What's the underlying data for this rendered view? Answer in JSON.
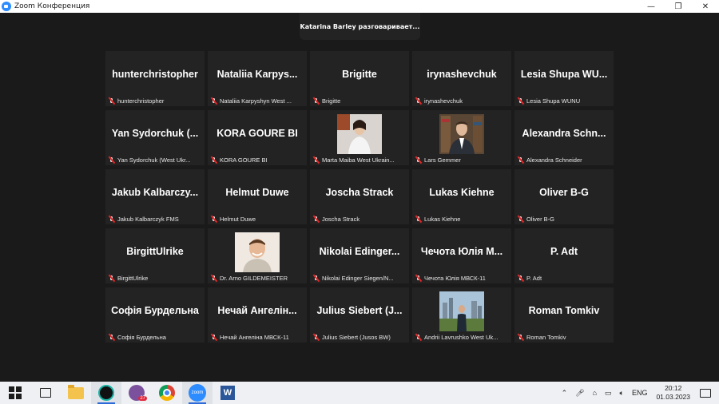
{
  "window": {
    "title": "Zoom Конференция",
    "controls": {
      "minimize": "—",
      "restore": "❐",
      "close": "✕"
    }
  },
  "banner": {
    "speaking": "Katarina Barley разговаривает..."
  },
  "tiles": [
    {
      "big": "hunterchristopher",
      "label": "hunterchristopher"
    },
    {
      "big": "Nataliia Karpys...",
      "label": "Nataliia Karpyshyn West ..."
    },
    {
      "big": "Brigitte",
      "label": "Brigitte"
    },
    {
      "big": "irynashevchuk",
      "label": "irynashevchuk"
    },
    {
      "big": "Lesia Shupa WU...",
      "label": "Lesia Shupa WUNU"
    },
    {
      "big": "Yan Sydorchuk (...",
      "label": "Yan Sydorchuk (West Ukr..."
    },
    {
      "big": "KORA GOURE BI",
      "label": "KORA GOURE BI"
    },
    {
      "big": "",
      "label": "Marta Maiba West Ukrain...",
      "photo": "woman-white-blouse"
    },
    {
      "big": "",
      "label": "Lars Gemmer",
      "photo": "man-suit-bookshelf"
    },
    {
      "big": "Alexandra Schn...",
      "label": "Alexandra Schneider"
    },
    {
      "big": "Jakub Kalbarczy...",
      "label": "Jakub Kalbarczyk FMS"
    },
    {
      "big": "Helmut Duwe",
      "label": "Helmut Duwe"
    },
    {
      "big": "Joscha Strack",
      "label": "Joscha Strack"
    },
    {
      "big": "Lukas Kiehne",
      "label": "Lukas Kiehne"
    },
    {
      "big": "Oliver B-G",
      "label": "Oliver B-G"
    },
    {
      "big": "BirgittUlrike",
      "label": "BirgittUlrike"
    },
    {
      "big": "",
      "label": "Dr. Arno GILDEMEISTER",
      "photo": "man-smiling"
    },
    {
      "big": "Nikolai Edinger...",
      "label": "Nikolai Edinger Siegen/N..."
    },
    {
      "big": "Чечота Юлія М...",
      "label": "Чечота Юлія МВСК-11"
    },
    {
      "big": "P. Adt",
      "label": "P. Adt"
    },
    {
      "big": "Софія Бурдельна",
      "label": "Софія Бурдельна"
    },
    {
      "big": "Нечай Ангелін...",
      "label": "Нечай Ангеліна МВСК-11"
    },
    {
      "big": "Julius Siebert (J...",
      "label": "Julius Siebert (Jusos BW)"
    },
    {
      "big": "",
      "label": "Andrii Lavrushko West Uk...",
      "photo": "man-city-skyline"
    },
    {
      "big": "Roman Tomkiv",
      "label": "Roman Tomkiv"
    }
  ],
  "taskbar": {
    "viber_badge": "27",
    "zoom_icon_text": "zoom",
    "word_icon_text": "W",
    "language": "ENG",
    "time": "20:12",
    "date": "01.03.2023"
  },
  "colors": {
    "accent": "#2d8cff",
    "tile_bg": "#232323",
    "mute_red": "#e02828"
  }
}
